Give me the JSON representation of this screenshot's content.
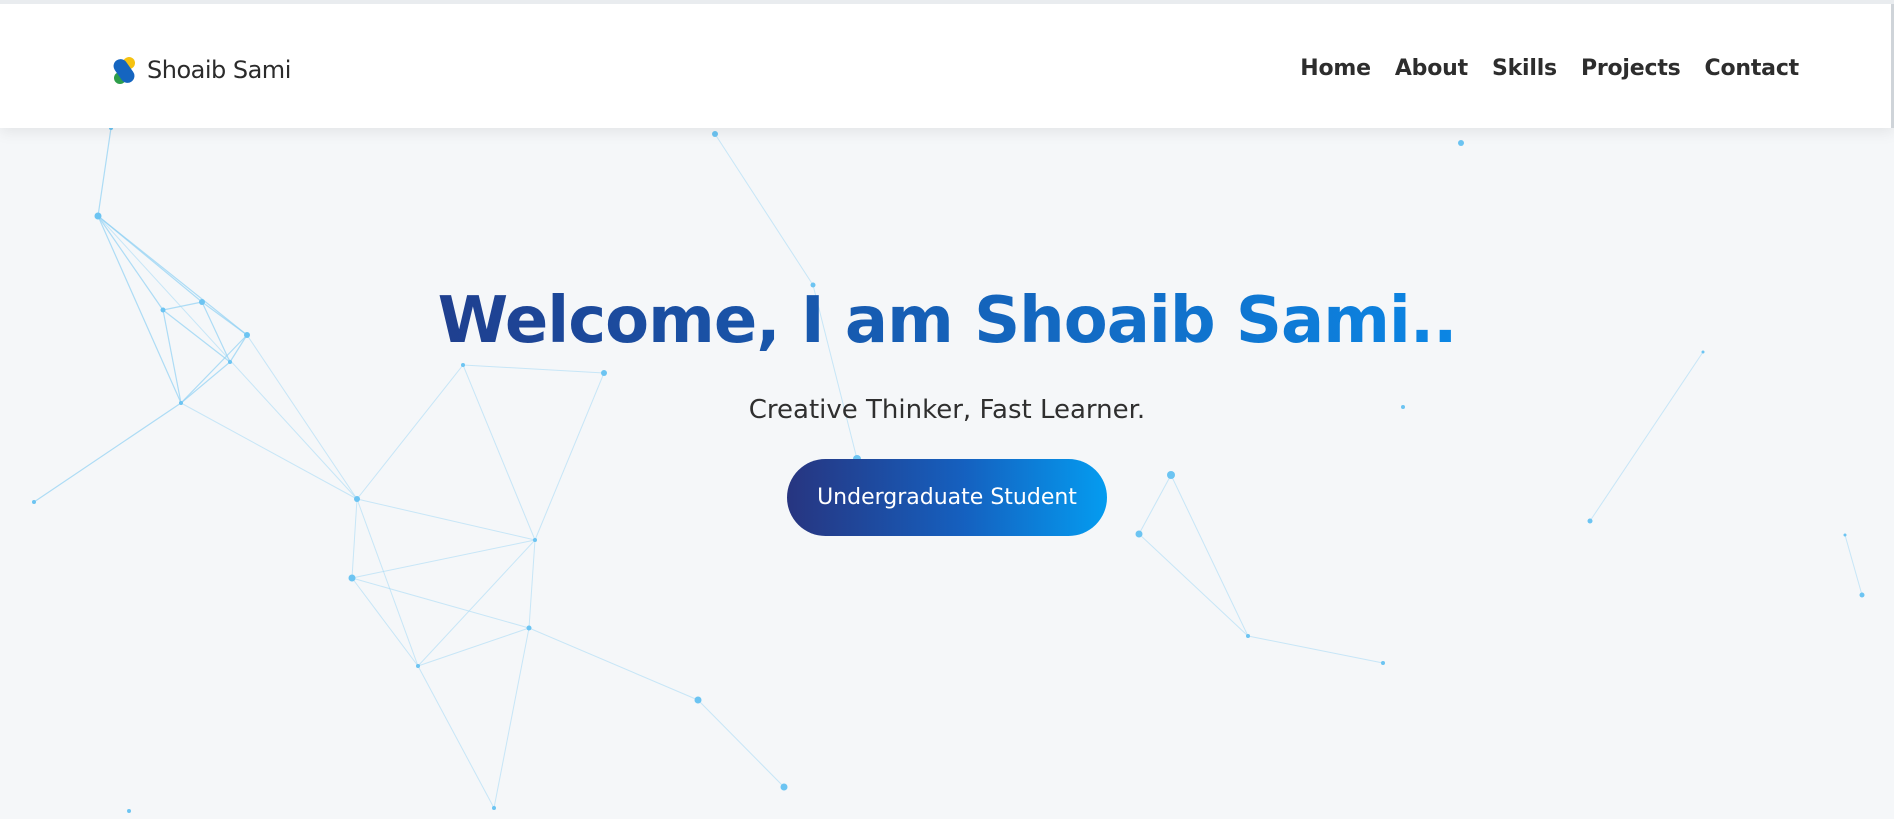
{
  "navbar": {
    "brand_name": "Shoaib Sami",
    "links": [
      "Home",
      "About",
      "Skills",
      "Projects",
      "Contact"
    ]
  },
  "hero": {
    "title": "Welcome, I am Shoaib Sami..",
    "subtitle": "Creative Thinker, Fast Learner.",
    "badge_label": "Undergraduate Student"
  },
  "colors": {
    "brand_blue": "#1561b8",
    "title_gradient_start": "#1f3f8f",
    "title_gradient_end": "#0b86e4",
    "badge_gradient_start": "#273580",
    "badge_gradient_end": "#049cf0",
    "particle": "#6cc4f2",
    "background": "#f5f7f9"
  },
  "icons": {
    "logo": "brand-logo-icon"
  }
}
